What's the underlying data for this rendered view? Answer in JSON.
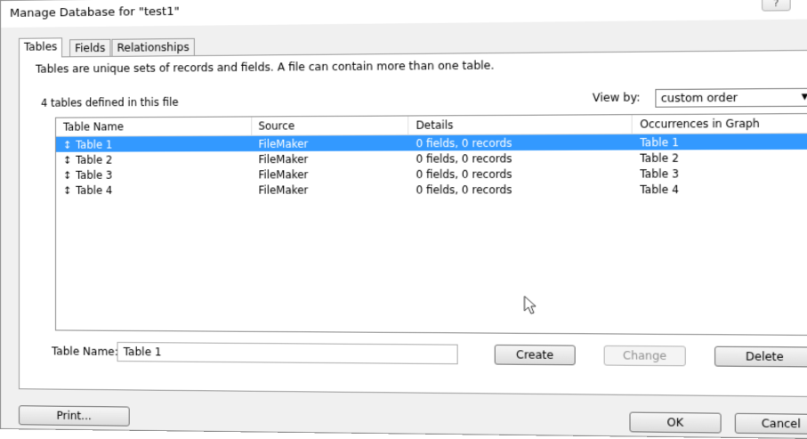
{
  "window": {
    "title": "Manage Database for \"test1\"",
    "help_label": "?",
    "close_label": "✕"
  },
  "tabs": [
    {
      "label": "Tables",
      "active": true
    },
    {
      "label": "Fields",
      "active": false
    },
    {
      "label": "Relationships",
      "active": false
    }
  ],
  "panel": {
    "description": "Tables are unique sets of records and fields. A file can contain more than one table.",
    "count_text": "4 tables defined in this file",
    "view_by_label": "View by:",
    "view_by_value": "custom order"
  },
  "table": {
    "columns": [
      "Table Name",
      "Source",
      "Details",
      "Occurrences in Graph"
    ],
    "rows": [
      {
        "name": "Table 1",
        "source": "FileMaker",
        "details": "0 fields, 0 records",
        "occurrences": "Table 1",
        "selected": true
      },
      {
        "name": "Table 2",
        "source": "FileMaker",
        "details": "0 fields, 0 records",
        "occurrences": "Table 2",
        "selected": false
      },
      {
        "name": "Table 3",
        "source": "FileMaker",
        "details": "0 fields, 0 records",
        "occurrences": "Table 3",
        "selected": false
      },
      {
        "name": "Table 4",
        "source": "FileMaker",
        "details": "0 fields, 0 records",
        "occurrences": "Table 4",
        "selected": false
      }
    ],
    "row_handle_glyph": "↕"
  },
  "editor": {
    "name_label": "Table Name:",
    "name_value": "Table 1",
    "create_label": "Create",
    "change_label": "Change",
    "delete_label": "Delete"
  },
  "footer": {
    "print_label": "Print...",
    "ok_label": "OK",
    "cancel_label": "Cancel"
  },
  "colors": {
    "selection": "#3399ff",
    "dialog_bg": "#f0f0f0"
  }
}
